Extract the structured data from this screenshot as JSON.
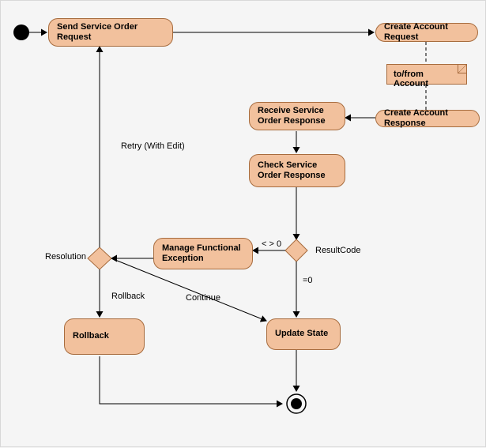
{
  "nodes": {
    "sendServiceOrder": "Send Service Order Request",
    "createAccountReq": "Create Account Request",
    "toFromAccount": "to/from Account",
    "createAccountResp": "Create Account Response",
    "receiveResp": "Receive Service Order Response",
    "checkResp": "Check Service Order Response",
    "manageExc": "Manage Functional Exception",
    "updateState": "Update State",
    "rollback": "Rollback"
  },
  "labels": {
    "retry": "Retry (With Edit)",
    "resultCode": "ResultCode",
    "neq0": "< > 0",
    "eq0": "=0",
    "resolution": "Resolution",
    "rollback": "Rollback",
    "continue": "Continue"
  }
}
